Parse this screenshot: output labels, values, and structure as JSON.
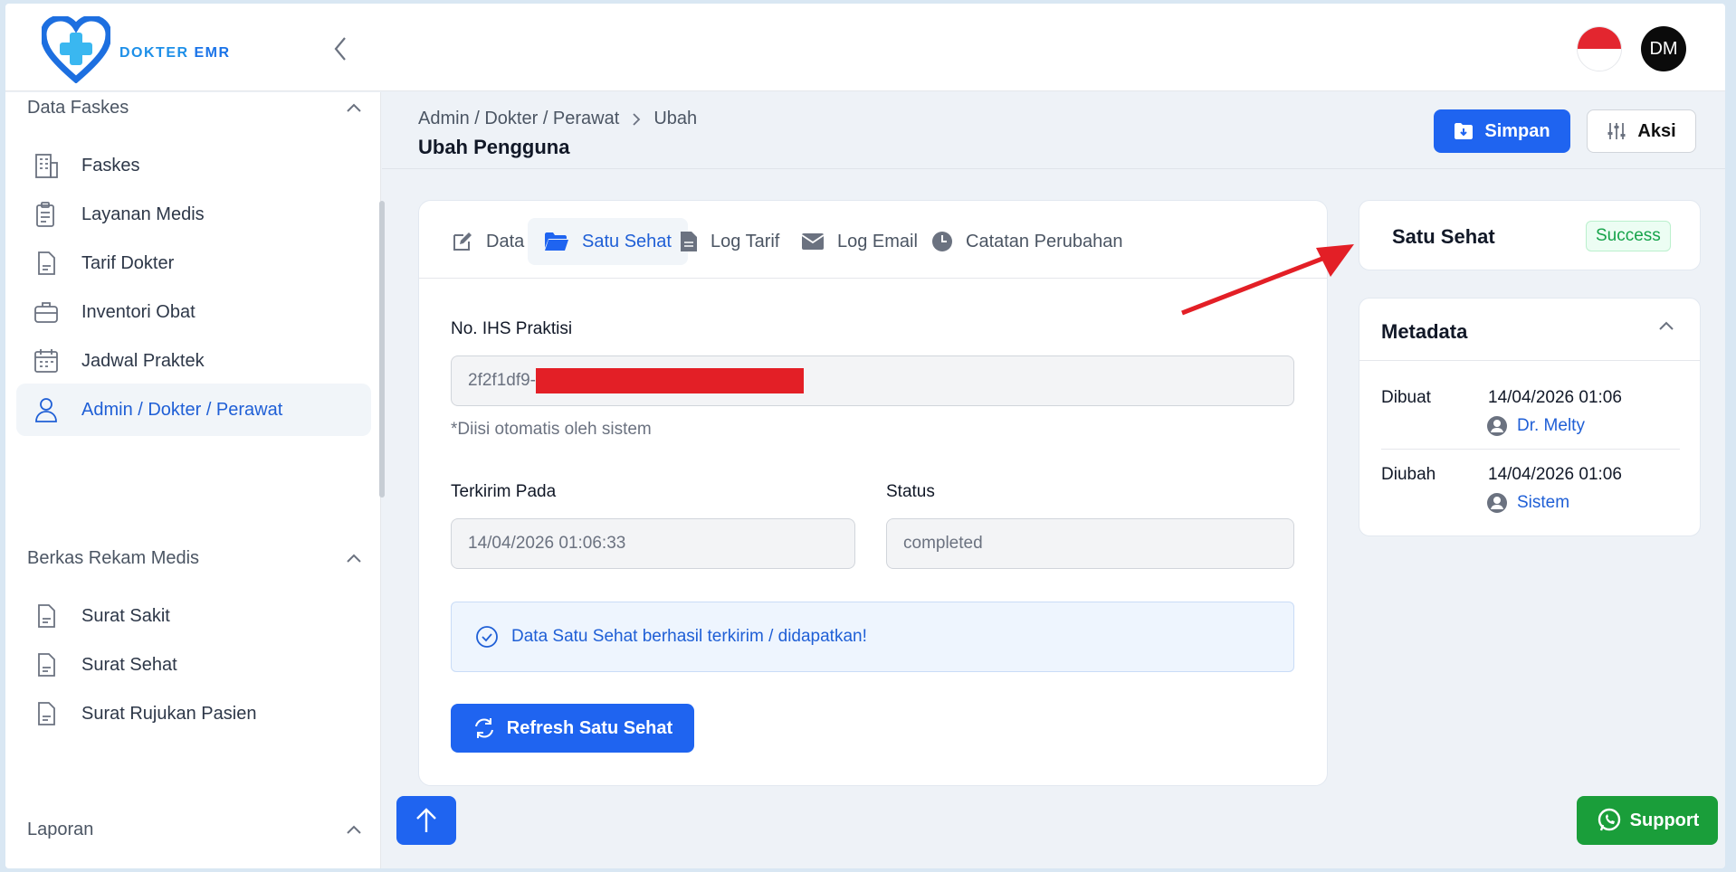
{
  "brand": {
    "name_part1": "DOKTER ",
    "name_part2": "EMR"
  },
  "user": {
    "initials": "DM"
  },
  "sidebar": {
    "sections": [
      {
        "label": "Data Faskes"
      },
      {
        "label": "Berkas Rekam Medis"
      },
      {
        "label": "Laporan"
      }
    ],
    "items": [
      {
        "label": "Faskes",
        "icon": "building-icon"
      },
      {
        "label": "Layanan Medis",
        "icon": "clipboard-icon"
      },
      {
        "label": "Tarif Dokter",
        "icon": "document-icon"
      },
      {
        "label": "Inventori Obat",
        "icon": "briefcase-icon"
      },
      {
        "label": "Jadwal Praktek",
        "icon": "calendar-icon"
      },
      {
        "label": "Admin / Dokter / Perawat",
        "icon": "user-icon",
        "active": true
      },
      {
        "label": "Surat Sakit",
        "icon": "document-icon"
      },
      {
        "label": "Surat Sehat",
        "icon": "document-icon"
      },
      {
        "label": "Surat Rujukan Pasien",
        "icon": "document-icon"
      }
    ]
  },
  "header": {
    "breadcrumb": [
      "Admin / Dokter / Perawat",
      "Ubah"
    ],
    "title": "Ubah Pengguna",
    "save_label": "Simpan",
    "action_label": "Aksi"
  },
  "tabs": [
    {
      "label": "Data",
      "icon": "edit-icon"
    },
    {
      "label": "Satu Sehat",
      "icon": "folder-open-icon",
      "active": true
    },
    {
      "label": "Log Tarif",
      "icon": "file-icon"
    },
    {
      "label": "Log Email",
      "icon": "envelope-icon"
    },
    {
      "label": "Catatan Perubahan",
      "icon": "clock-icon"
    }
  ],
  "form": {
    "ihs_label": "No. IHS Praktisi",
    "ihs_value": "2f2f1df9-",
    "ihs_hint": "*Diisi otomatis oleh sistem",
    "sent_label": "Terkirim Pada",
    "sent_value": "14/04/2026 01:06:33",
    "status_label": "Status",
    "status_value": "completed",
    "alert_text": "Data Satu Sehat berhasil terkirim / didapatkan!",
    "refresh_label": "Refresh Satu Sehat"
  },
  "status_card": {
    "title": "Satu Sehat",
    "badge": "Success",
    "badge_color": "#16a34a"
  },
  "metadata": {
    "title": "Metadata",
    "rows": [
      {
        "key": "Dibuat",
        "date": "14/04/2026 01:06",
        "user": "Dr. Melty"
      },
      {
        "key": "Diubah",
        "date": "14/04/2026 01:06",
        "user": "Sistem"
      }
    ]
  },
  "support_label": "Support",
  "colors": {
    "primary": "#1f64f0",
    "accent_text": "#1f5fd6",
    "support": "#1a9e3a",
    "annotation_arrow": "#e31f26"
  }
}
